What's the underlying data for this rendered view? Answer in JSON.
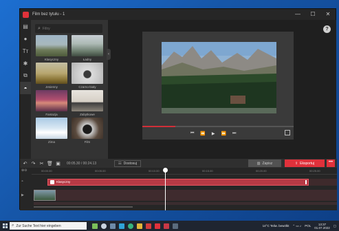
{
  "window": {
    "title": "Film bez tytułu - 1",
    "controls": {
      "minimize": "—",
      "maximize": "☐",
      "close": "✕"
    }
  },
  "rail": {
    "items": [
      {
        "icon": "media-icon",
        "glyph": "▤"
      },
      {
        "icon": "circle-icon",
        "glyph": "●"
      },
      {
        "icon": "text-icon",
        "glyph": "Tт"
      },
      {
        "icon": "effects-icon",
        "glyph": "✱"
      },
      {
        "icon": "transitions-icon",
        "glyph": "⧉"
      },
      {
        "icon": "filters-icon",
        "glyph": "◓"
      }
    ],
    "active_index": 5
  },
  "filters": {
    "search_placeholder": "Filtry",
    "items": [
      {
        "label": "Klasyczny"
      },
      {
        "label": "Ładny"
      },
      {
        "label": "Jesienny"
      },
      {
        "label": "Czarno-biały"
      },
      {
        "label": "Fantazja"
      },
      {
        "label": "Zabytkowe"
      },
      {
        "label": "Zima"
      },
      {
        "label": "Film"
      }
    ]
  },
  "player": {
    "help": "?",
    "progress": 0.22,
    "controls": [
      "⏮",
      "⏪",
      "▶",
      "⏩",
      "⏭"
    ]
  },
  "toolbar": {
    "timecode": "00:05.30 / 00:24.13",
    "adjust_label": "Dostosuj",
    "save_label": "Zapisz",
    "export_label": "Eksportuj",
    "more": "•••"
  },
  "timeline": {
    "ruler": [
      "00:00.00",
      "00:05.00",
      "00:10.00",
      "00:15.00",
      "00:20.00",
      "00:25.00"
    ],
    "filter_track_label": "Klasyczny",
    "colors": {
      "accent": "#e0313b",
      "track": "#b73a45"
    }
  },
  "taskbar": {
    "search_placeholder": "Zur Suche Text hier eingeben",
    "weather": "14°C  Teilw. bewölkt",
    "lang": "POL",
    "time": "13:37",
    "date": "01.07.2022"
  }
}
